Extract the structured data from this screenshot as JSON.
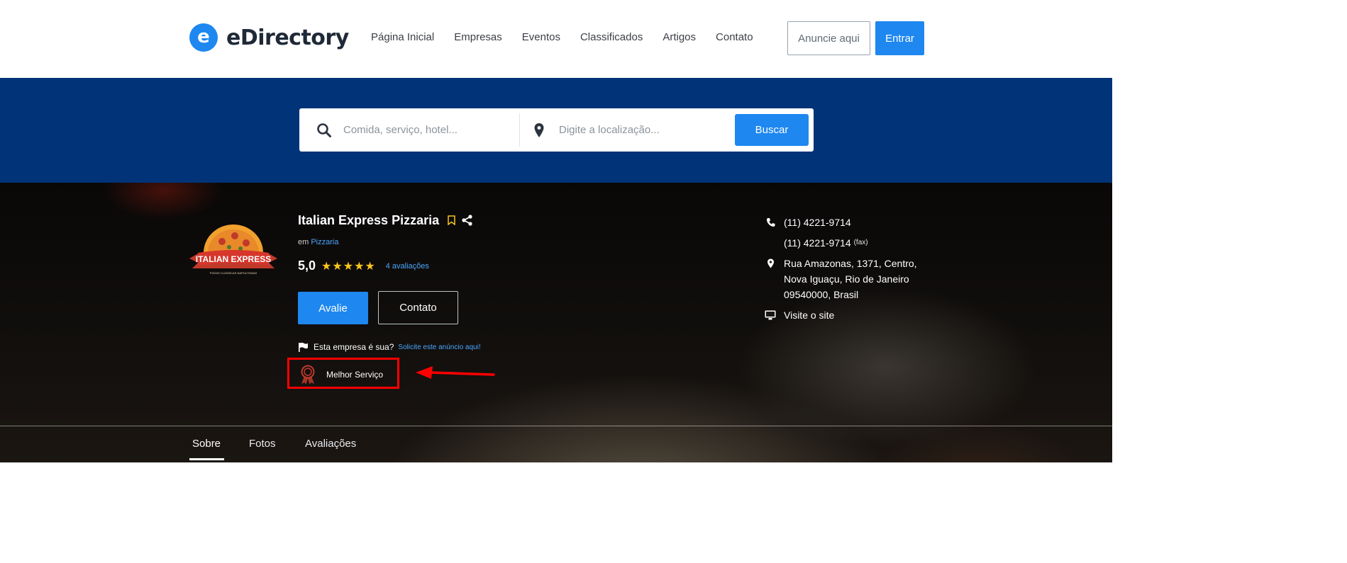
{
  "header": {
    "logo_mark": "e",
    "logo_text": "eDirectory",
    "nav": [
      "Página Inicial",
      "Empresas",
      "Eventos",
      "Classificados",
      "Artigos",
      "Contato"
    ],
    "advertise_label": "Anuncie aqui",
    "login_label": "Entrar"
  },
  "search": {
    "keyword_placeholder": "Comida, serviço, hotel...",
    "location_placeholder": "Digite a localização...",
    "button_label": "Buscar"
  },
  "listing": {
    "logo_text": "ITALIAN EXPRESS",
    "logo_subtext": "PIZZAS CLÁSSICAS NAPOLITANAS",
    "name": "Italian Express Pizzaria",
    "category_prefix": "em",
    "category": "Pizzaria",
    "rating": "5,0",
    "stars": "★★★★★",
    "reviews_count": "4 avaliações",
    "rate_button": "Avalie",
    "contact_button": "Contato",
    "claim_question": "Esta empresa é sua?",
    "claim_link": "Solicite este anúncio aqui!",
    "badge_label": "Melhor Serviço",
    "phone": "(11) 4221-9714",
    "fax": "(11) 4221-9714",
    "fax_label": "(fax)",
    "address_line1": "Rua Amazonas, 1371, Centro,",
    "address_line2": "Nova Iguaçu, Rio de Janeiro",
    "address_line3": "09540000, Brasil",
    "website_label": "Visite o site"
  },
  "tabs": [
    "Sobre",
    "Fotos",
    "Avaliações"
  ],
  "colors": {
    "brand_blue": "#1e87f0",
    "band_navy": "#003378",
    "highlight_red": "#ff0000",
    "star_gold": "#f7c51e"
  }
}
